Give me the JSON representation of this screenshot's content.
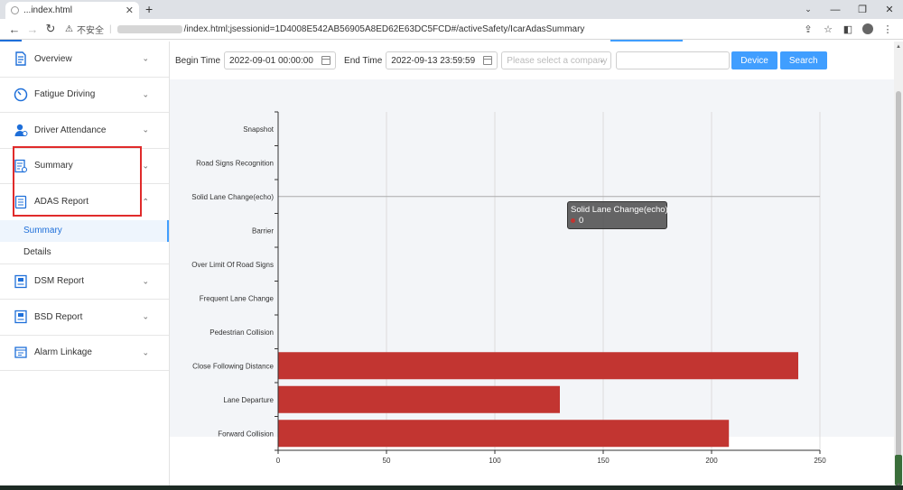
{
  "browser": {
    "tab_title": "...index.html",
    "url": "/index.html;jsessionid=1D4008E542AB56905A8ED62E63DC5FCD#/activeSafety/IcarAdasSummary",
    "security_label": "不安全"
  },
  "sidebar": {
    "items": [
      {
        "label": "Overview",
        "icon": "overview-icon"
      },
      {
        "label": "Fatigue Driving",
        "icon": "gauge-icon"
      },
      {
        "label": "Driver Attendance",
        "icon": "driver-icon"
      },
      {
        "label": "Summary",
        "icon": "summary-doc-icon"
      },
      {
        "label": "ADAS Report",
        "icon": "adas-report-icon",
        "expanded": true,
        "children": [
          {
            "label": "Summary",
            "active": true
          },
          {
            "label": "Details"
          }
        ]
      },
      {
        "label": "DSM Report",
        "icon": "dsm-report-icon"
      },
      {
        "label": "BSD Report",
        "icon": "bsd-report-icon"
      },
      {
        "label": "Alarm Linkage",
        "icon": "alarm-linkage-icon"
      }
    ]
  },
  "filters": {
    "begin_label": "Begin Time",
    "begin_value": "2022-09-01 00:00:00",
    "end_label": "End Time",
    "end_value": "2022-09-13 23:59:59",
    "company_placeholder": "Please select a company",
    "device_button": "Device",
    "search_button": "Search"
  },
  "chart_data": {
    "type": "bar",
    "orientation": "horizontal",
    "categories": [
      "Forward Collision",
      "Lane Departure",
      "Close Following Distance",
      "Pedestrian Collision",
      "Frequent Lane Change",
      "Over Limit Of Road Signs",
      "Barrier",
      "Solid Lane Change(echo)",
      "Road Signs Recognition",
      "Snapshot"
    ],
    "values": [
      208,
      130,
      240,
      0,
      0,
      0,
      0,
      0,
      0,
      0
    ],
    "xlim": [
      0,
      250
    ],
    "xticks": [
      0,
      50,
      100,
      150,
      200,
      250
    ],
    "bar_color": "#c23531",
    "grid": true,
    "tooltip": {
      "category": "Solid Lane Change(echo)",
      "value": "0"
    }
  },
  "colors": {
    "accent": "#409eff",
    "highlight_box": "#e02b2b"
  }
}
